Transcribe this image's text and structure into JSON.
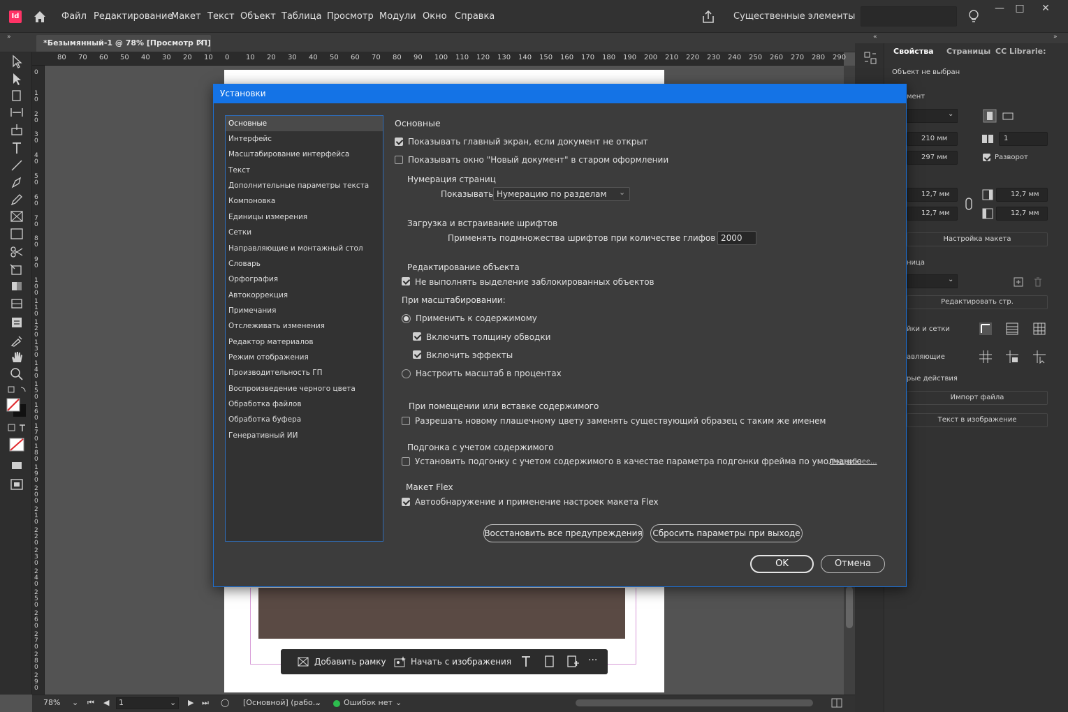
{
  "app": {
    "logo": "Id",
    "colors": {
      "accent": "#1473e6",
      "brand": "#ff3366"
    }
  },
  "menu": [
    "Файл",
    "Редактирование",
    "Макет",
    "Текст",
    "Объект",
    "Таблица",
    "Просмотр",
    "Модули",
    "Окно",
    "Справка"
  ],
  "workspace": "Существенные элементы",
  "document_tab": {
    "title": "*Безымянный-1 @ 78% [Просмотр ГП]",
    "close": "×"
  },
  "ruler_top": [
    "80",
    "70",
    "60",
    "50",
    "40",
    "30",
    "20",
    "10",
    "0",
    "10",
    "20",
    "30",
    "40",
    "50",
    "60",
    "70",
    "80",
    "90",
    "100",
    "110",
    "120",
    "130",
    "140",
    "150",
    "160",
    "170",
    "180",
    "190",
    "200",
    "210",
    "220",
    "230",
    "240",
    "250",
    "260",
    "270",
    "280",
    "290"
  ],
  "ruler_left": [
    "0",
    "10",
    "20",
    "30",
    "40",
    "50",
    "60",
    "70",
    "80",
    "90",
    "100",
    "110",
    "120",
    "130",
    "140",
    "150",
    "160",
    "170",
    "180",
    "190",
    "200",
    "210",
    "220",
    "230",
    "240",
    "250",
    "260",
    "270",
    "280",
    "290"
  ],
  "taskbar": {
    "add_frame": "Добавить рамку",
    "start_image": "Начать с изображения",
    "more": "···"
  },
  "status": {
    "zoom": "78%",
    "page": "1",
    "style": "[Основной] (рабо...",
    "errors": "Ошибок нет"
  },
  "right_panel": {
    "tabs": [
      "Свойства",
      "Страницы",
      "CC Librarie:"
    ],
    "no_selection": "Объект не выбран",
    "doc_label": "мент",
    "width": "210 мм",
    "height": "297 мм",
    "pages": "1",
    "facing_pages": "Разворот",
    "margin_top": "12,7 мм",
    "margin_bottom": "12,7 мм",
    "margin_left": "12,7 мм",
    "margin_right": "12,7 мм",
    "layout_btn": "Настройка макета",
    "page_label": "ница",
    "edit_page_btn": "Редактировать стр.",
    "grids_label": "йки и сетки",
    "guides_label": "авляющие",
    "quick_actions_label": "рые действия",
    "import_btn": "Импорт файла",
    "text_to_image_btn": "Текст в изображение"
  },
  "dialog": {
    "title": "Установки",
    "categories": [
      "Основные",
      "Интерфейс",
      "Масштабирование интерфейса",
      "Текст",
      "Дополнительные параметры текста",
      "Компоновка",
      "Единицы измерения",
      "Сетки",
      "Направляющие и монтажный стол",
      "Словарь",
      "Орфография",
      "Автокоррекция",
      "Примечания",
      "Отслеживать изменения",
      "Редактор материалов",
      "Режим отображения",
      "Производительность ГП",
      "Воспроизведение черного цвета",
      "Обработка файлов",
      "Обработка буфера",
      "Генеративный ИИ"
    ],
    "section_title": "Основные",
    "show_home": "Показывать главный экран, если документ не открыт",
    "legacy_new_doc": "Показывать окно \"Новый документ\" в старом оформлении",
    "page_numbering": "Нумерация страниц",
    "show_label": "Показывать:",
    "show_value": "Нумерацию по разделам",
    "font_loading": "Загрузка и встраивание шрифтов",
    "subset_label": "Применять подмножества шрифтов при количестве глифов более:",
    "subset_value": "2000",
    "object_editing": "Редактирование объекта",
    "no_locked_select": "Не выполнять выделение заблокированных объектов",
    "when_scaling": "При масштабировании:",
    "apply_to_content": "Применить к содержимому",
    "include_stroke": "Включить толщину обводки",
    "include_effects": "Включить эффекты",
    "adjust_percent": "Настроить масштаб в процентах",
    "when_placing": "При помещении или вставке содержимого",
    "allow_swatch": "Разрешать новому плашечному цвету заменять существующий образец с таким же именем",
    "content_aware": "Подгонка с учетом содержимого",
    "content_aware_default": "Установить подгонку с учетом содержимого в качестве параметра подгонки фрейма по умолчанию",
    "more_link": "Подробнее...",
    "flex_layout": "Макет Flex",
    "flex_auto": "Автообнаружение и применение настроек макета Flex",
    "reset_warnings": "Восстановить все предупреждения",
    "reset_on_exit": "Сбросить параметры при выходе",
    "ok": "OK",
    "cancel": "Отмена"
  }
}
